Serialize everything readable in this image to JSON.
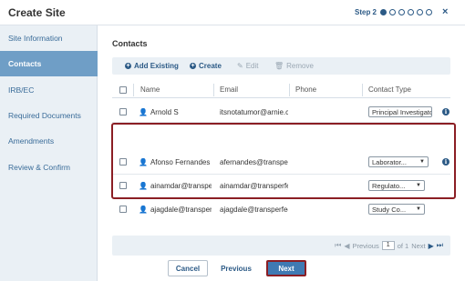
{
  "header": {
    "title": "Create Site",
    "step_label": "Step 2",
    "steps": [
      {
        "state": "complete"
      },
      {
        "state": "current"
      },
      {
        "state": "pending"
      },
      {
        "state": "pending"
      },
      {
        "state": "pending"
      },
      {
        "state": "pending"
      }
    ],
    "close_icon": "×"
  },
  "sidebar": {
    "items": [
      {
        "label": "Site Information",
        "active": false
      },
      {
        "label": "Contacts",
        "active": true
      },
      {
        "label": "IRB/EC",
        "active": false
      },
      {
        "label": "Required Documents",
        "active": false
      },
      {
        "label": "Amendments",
        "active": false
      },
      {
        "label": "Review & Confirm",
        "active": false
      }
    ]
  },
  "main": {
    "section_title": "Contacts",
    "toolbar": {
      "add_existing": "Add Existing",
      "create": "Create",
      "edit": "Edit",
      "remove": "Remove"
    },
    "columns": {
      "name": "Name",
      "email": "Email",
      "phone": "Phone",
      "contact_type": "Contact Type"
    },
    "rows": [
      {
        "name": "Arnold S",
        "email": "itsnotatumor@arnie.com",
        "phone": "",
        "contact_type": "Principal Investigator",
        "type_style": "box",
        "has_info": true
      },
      {
        "name": "Afonso Fernandes",
        "email": "afernandes@transperfect.com",
        "phone": "",
        "contact_type": "Laborator...",
        "type_style": "select",
        "has_info": true
      },
      {
        "name": "ainamdar@transperfect.com",
        "email": "ainamdar@transperfect.com",
        "phone": "",
        "contact_type": "Regulato...",
        "type_style": "select",
        "has_info": false
      },
      {
        "name": "ajagdale@transperfect.com",
        "email": "ajagdale@transperfect.com",
        "phone": "",
        "contact_type": "Study Co...",
        "type_style": "select",
        "has_info": false
      }
    ],
    "pager": {
      "previous": "Previous",
      "page": "1",
      "of": "of 1",
      "next": "Next"
    }
  },
  "footer": {
    "cancel": "Cancel",
    "previous": "Previous",
    "next": "Next"
  },
  "colors": {
    "brand": "#2c5a86",
    "sidebar_active": "#6f9ec6",
    "highlight_border": "#8b1e24",
    "next_button": "#3f7ab3"
  }
}
